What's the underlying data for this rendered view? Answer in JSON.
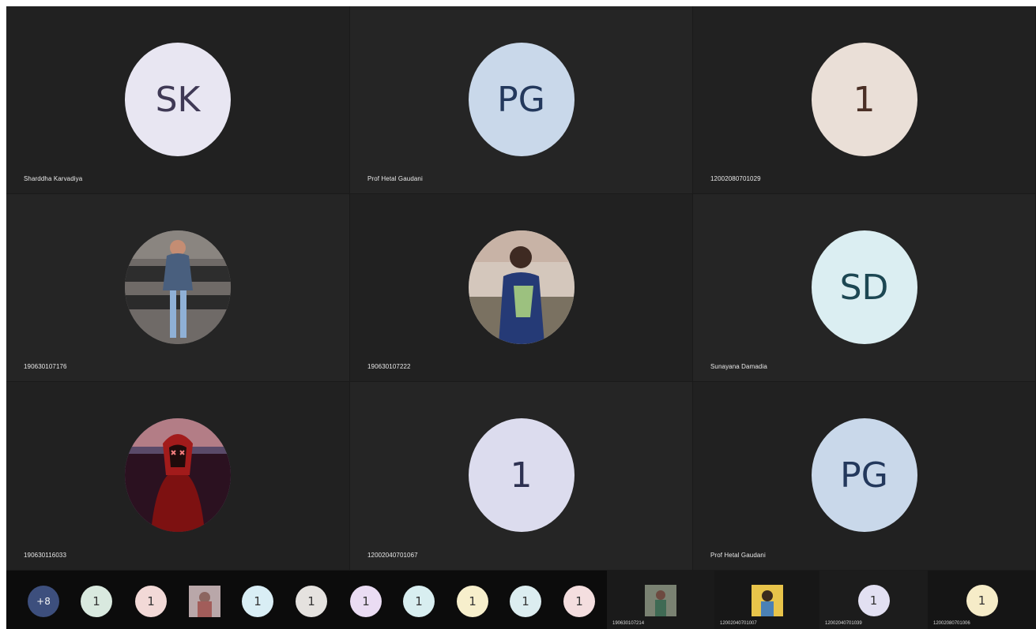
{
  "tiles": [
    {
      "initials": "SK",
      "name": "Sharddha Karvadiya",
      "bg": "#e8e6f2",
      "fg": "#3f3955"
    },
    {
      "initials": "PG",
      "name": "Prof Hetal Gaudani",
      "bg": "#c9d8ea",
      "fg": "#23385c"
    },
    {
      "initials": "1",
      "name": "12002080701029",
      "bg": "#eadfd7",
      "fg": "#4a2f25"
    },
    {
      "initials": "",
      "name": "190630107176",
      "photo": "standing-woman-photo"
    },
    {
      "initials": "",
      "name": "190630107222",
      "photo": "young-man-photo"
    },
    {
      "initials": "SD",
      "name": "Sunayana Damadia",
      "bg": "#dbeef2",
      "fg": "#1c4753"
    },
    {
      "initials": "",
      "name": "190630116033",
      "photo": "mask-profile-photo"
    },
    {
      "initials": "1",
      "name": "12002040701067",
      "bg": "#dcdcee",
      "fg": "#2d3151"
    },
    {
      "initials": "PG",
      "name": "Prof Hetal Gaudani",
      "bg": "#c9d8ea",
      "fg": "#23385c"
    }
  ],
  "strip": {
    "more_label": "+8",
    "items": [
      {
        "label": "1",
        "bg": "#d9e9df"
      },
      {
        "label": "1",
        "bg": "#f2d9d7"
      },
      {
        "label": "",
        "photo": true
      },
      {
        "label": "1",
        "bg": "#d9eef5"
      },
      {
        "label": "1",
        "bg": "#e5e2df"
      },
      {
        "label": "1",
        "bg": "#eadcf3"
      },
      {
        "label": "1",
        "bg": "#d8eef0"
      },
      {
        "label": "1",
        "bg": "#f7efcc"
      },
      {
        "label": "1",
        "bg": "#dcedf0"
      },
      {
        "label": "1",
        "bg": "#f4dedf"
      }
    ]
  },
  "mini_tiles": [
    {
      "name": "190630107214",
      "photo": true
    },
    {
      "name": "12002040701007",
      "photo": true
    },
    {
      "name": "12002040701039",
      "initial": "1",
      "bg": "#e2e0f2"
    },
    {
      "name": "12002080701006",
      "initial": "1",
      "bg": "#f6ecc8"
    }
  ]
}
